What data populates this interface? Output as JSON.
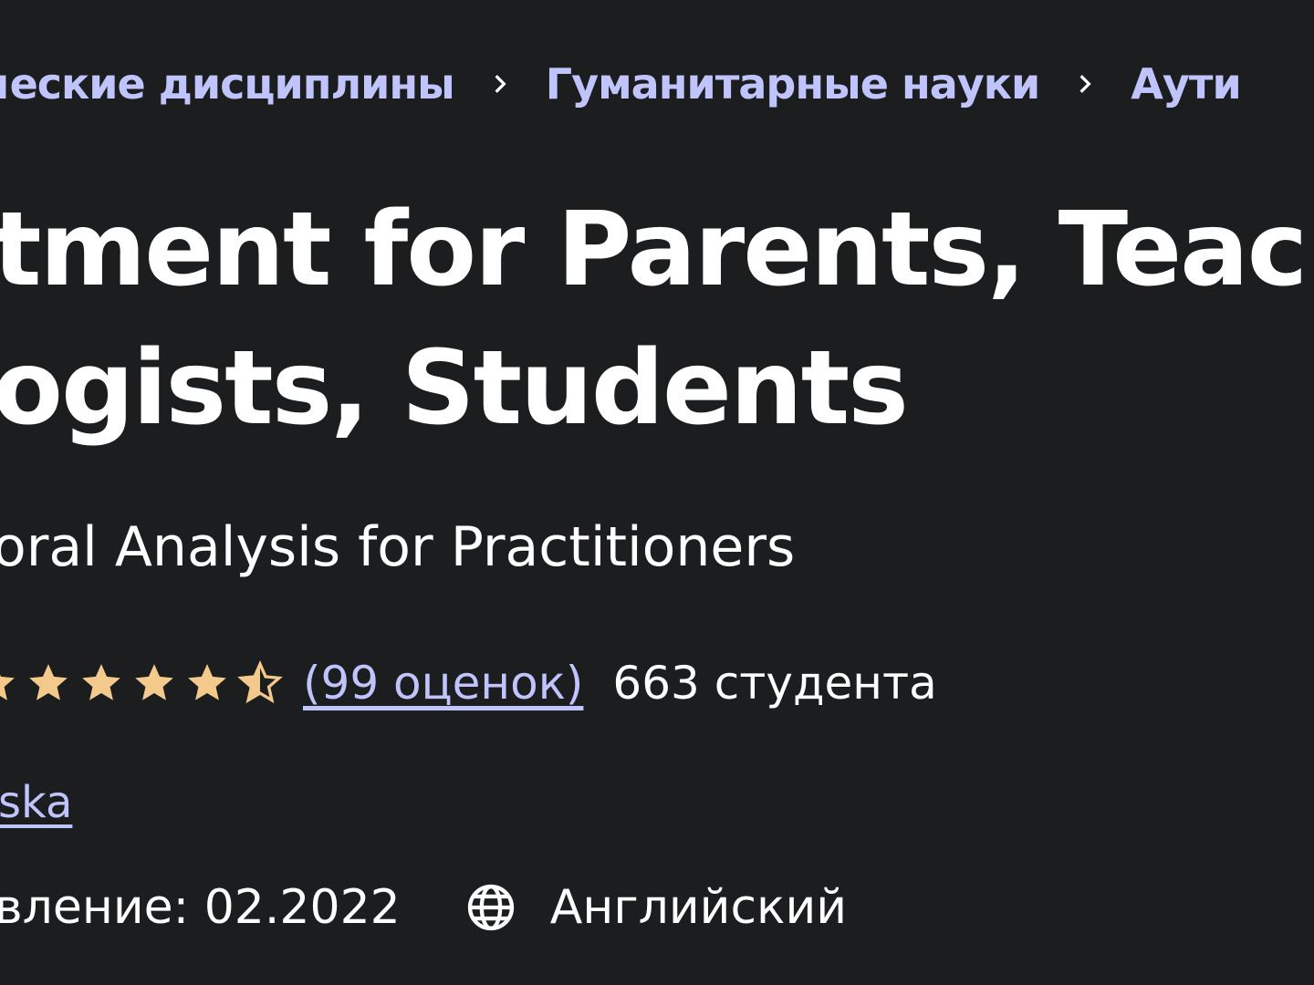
{
  "breadcrumb": {
    "items": [
      {
        "label": "ческие дисциплины"
      },
      {
        "label": "Гуманитарные науки"
      },
      {
        "label": "Аути"
      }
    ]
  },
  "course": {
    "title_line1": "tment for Parents, Teach",
    "title_line2": "ogists, Students",
    "subtitle": "oral Analysis for Practitioners",
    "rating": {
      "stars": 4.5,
      "ratings_link": "(99 оценок)",
      "students": "663 студента"
    },
    "instructor": "ska",
    "updated": "вление: 02.2022",
    "language": "Английский"
  },
  "colors": {
    "background": "#1c1d1f",
    "link": "#c0c4fc",
    "star": "#f3ca8c",
    "text": "#ffffff"
  },
  "icons": {
    "separator": "chevron-right-icon",
    "star": "star-icon",
    "half_star": "star-half-icon",
    "language": "globe-icon"
  }
}
